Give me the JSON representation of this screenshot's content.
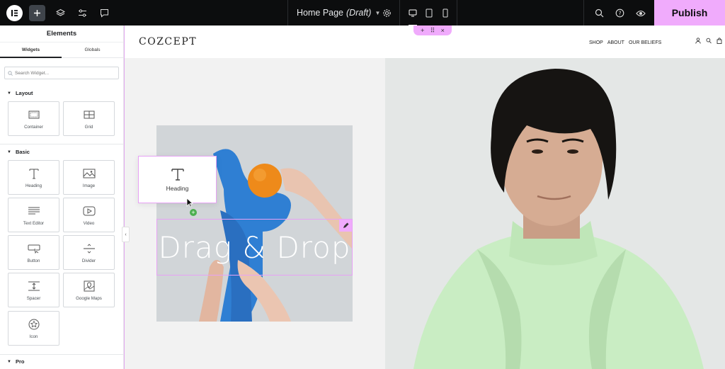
{
  "topbar": {
    "page_title": "Home Page",
    "page_status": "(Draft)",
    "publish_label": "Publish"
  },
  "panel": {
    "title": "Elements",
    "tabs": [
      "Widgets",
      "Globals"
    ],
    "search_placeholder": "Search Widget...",
    "sections": {
      "layout": "Layout",
      "basic": "Basic",
      "pro": "Pro"
    },
    "layout_widgets": [
      {
        "label": "Container",
        "icon": "container-icon"
      },
      {
        "label": "Grid",
        "icon": "grid-icon"
      }
    ],
    "basic_widgets": [
      {
        "label": "Heading",
        "icon": "heading-icon"
      },
      {
        "label": "Image",
        "icon": "image-icon"
      },
      {
        "label": "Text Editor",
        "icon": "text-editor-icon"
      },
      {
        "label": "Video",
        "icon": "video-icon"
      },
      {
        "label": "Button",
        "icon": "button-icon"
      },
      {
        "label": "Divider",
        "icon": "divider-icon"
      },
      {
        "label": "Spacer",
        "icon": "spacer-icon"
      },
      {
        "label": "Google Maps",
        "icon": "map-icon"
      },
      {
        "label": "Icon",
        "icon": "star-icon"
      }
    ]
  },
  "canvas": {
    "site_logo": "COZCEPT",
    "nav": [
      "SHOP",
      "ABOUT",
      "OUR BELIEFS"
    ],
    "headline": "Drag & Drop",
    "dragging_widget": "Heading"
  },
  "colors": {
    "accent": "#f0abfc",
    "topbar_bg": "#0c0d0e",
    "hoodie": "#c9edc3"
  }
}
